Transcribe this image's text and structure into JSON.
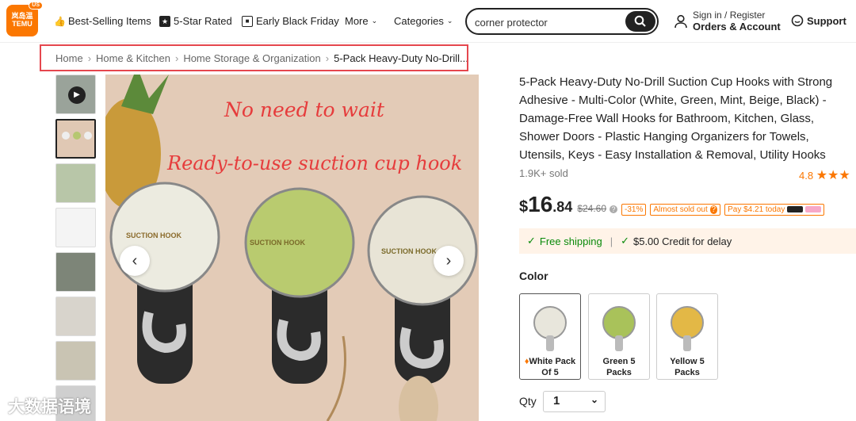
{
  "header": {
    "logo_lines": [
      "岚岛温",
      "TEMU"
    ],
    "logo_badge": "US",
    "nav": [
      {
        "icon": "thumbs-up-icon",
        "label": "Best-Selling Items"
      },
      {
        "icon": "star-badge-icon",
        "label": "5-Star Rated"
      },
      {
        "icon": "calendar-icon",
        "label": "Early Black Friday"
      },
      {
        "icon": "",
        "label": "More"
      },
      {
        "icon": "",
        "label": "Categories"
      }
    ],
    "search_value": "corner protector",
    "account_line1": "Sign in / Register",
    "account_line2": "Orders & Account",
    "support": "Support"
  },
  "breadcrumb": [
    "Home",
    "Home & Kitchen",
    "Home Storage & Organization",
    "5-Pack Heavy-Duty No-Drill..."
  ],
  "gallery": {
    "image_text_1": "No need to wait",
    "image_text_2": "Ready-to-use suction cup hook",
    "hook_label": "SUCTION HOOK"
  },
  "product": {
    "title": "5-Pack Heavy-Duty No-Drill Suction Cup Hooks with Strong Adhesive - Multi-Color (White, Green, Mint, Beige, Black) - Damage-Free Wall Hooks for Bathroom, Kitchen, Glass, Shower Doors - Plastic Hanging Organizers for Towels, Utensils, Keys - Easy Installation & Removal, Utility Hooks",
    "sold": "1.9K+ sold",
    "rating": "4.8",
    "price_currency": "$",
    "price_int": "16",
    "price_dec": ".84",
    "orig_price": "$24.60",
    "discount": "-31%",
    "almost": "Almost sold out",
    "pay": "Pay $4.21 today",
    "free_shipping": "Free shipping",
    "credit": "$5.00 Credit for delay",
    "color_label": "Color",
    "options": [
      {
        "label1": "White Pack",
        "label2": "Of 5",
        "color": "#e8e6dc"
      },
      {
        "label1": "Green 5",
        "label2": "Packs",
        "color": "#a9c25a"
      },
      {
        "label1": "Yellow 5",
        "label2": "Packs",
        "color": "#e3b846"
      }
    ],
    "qty_label": "Qty",
    "qty_value": "1"
  },
  "watermark": "大数据语境",
  "colors": {
    "brand": "#fb7701",
    "highlight": "#e5474e"
  }
}
